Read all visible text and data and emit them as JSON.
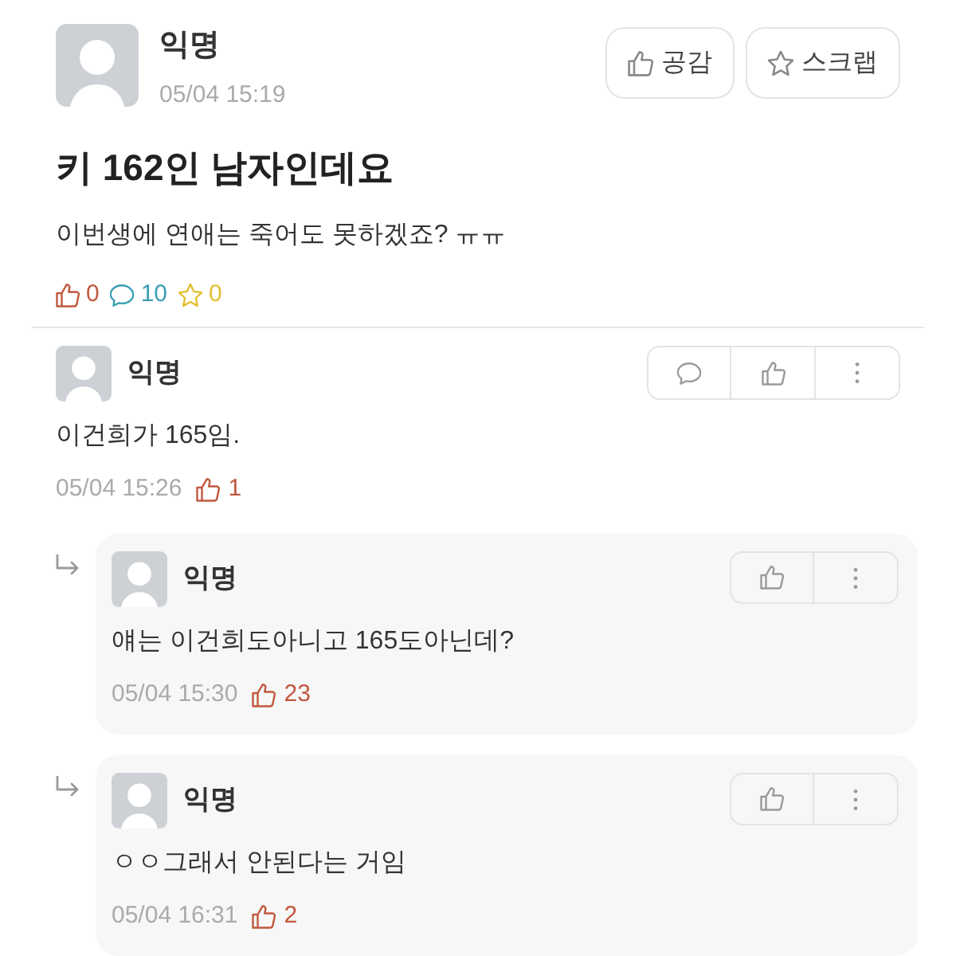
{
  "post": {
    "author": "익명",
    "time": "05/04 15:19",
    "buttons": [
      {
        "kind": "like",
        "label": "공감"
      },
      {
        "kind": "scrap",
        "label": "스크랩"
      }
    ],
    "title": "키 162인 남자인데요",
    "body": "이번생에 연애는 죽어도 못하겠죠? ㅠㅠ",
    "stats": [
      {
        "kind": "like",
        "count": "0",
        "color": "#c0583e"
      },
      {
        "kind": "comment",
        "count": "10",
        "color": "#3a9fb5"
      },
      {
        "kind": "scrap",
        "count": "0",
        "color": "#e2c030"
      }
    ]
  },
  "comments": [
    {
      "author": "익명",
      "text": "이건희가 165임.",
      "time": "05/04 15:26",
      "likes": "1",
      "actions": [
        {
          "kind": "comment"
        },
        {
          "kind": "like"
        },
        {
          "kind": "more"
        }
      ],
      "replies": [
        {
          "author": "익명",
          "text": "얘는 이건희도아니고 165도아닌데?",
          "time": "05/04 15:30",
          "likes": "23",
          "actions": [
            {
              "kind": "like"
            },
            {
              "kind": "more"
            }
          ]
        },
        {
          "author": "익명",
          "text": "ㅇㅇ그래서 안된다는 거임",
          "time": "05/04 16:31",
          "likes": "2",
          "actions": [
            {
              "kind": "like"
            },
            {
              "kind": "more"
            }
          ]
        }
      ]
    }
  ]
}
